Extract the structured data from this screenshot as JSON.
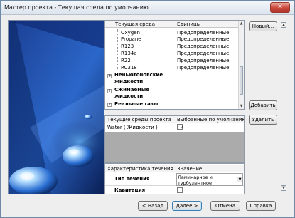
{
  "window": {
    "title": "Мастер проекта - Текущая среда по умолчанию",
    "close_label": "✕"
  },
  "fluids_table": {
    "headers": [
      "Текущая среда",
      "Единицы"
    ],
    "items": [
      {
        "name": "Oxygen",
        "units": "Предопределенные"
      },
      {
        "name": "Propane",
        "units": "Предопределенные"
      },
      {
        "name": "R123",
        "units": "Предопределенные"
      },
      {
        "name": "R134a",
        "units": "Предопределенные"
      },
      {
        "name": "R22",
        "units": "Предопределенные"
      },
      {
        "name": "RC318",
        "units": "Предопределенные"
      }
    ],
    "groups": [
      {
        "label": "Неньютоновские жидкости"
      },
      {
        "label": "Сжимаемые жидкости"
      },
      {
        "label": "Реальные газы"
      }
    ]
  },
  "project_fluids": {
    "headers": [
      "Текущие среды проекта",
      "Выбранные по умолчанию"
    ],
    "rows": [
      {
        "name": "Water ( Жидкости )",
        "checked": true
      }
    ]
  },
  "flow_props": {
    "headers": [
      "Характеристика течения",
      "Значение"
    ],
    "rows": [
      {
        "name": "Тип течения",
        "value": "Ламинарное и турбулентное"
      },
      {
        "name": "Кавитация",
        "value": ""
      }
    ]
  },
  "buttons": {
    "new": "Новый...",
    "add": "Добавить",
    "remove": "Удалить",
    "back": "< Назад",
    "next": "Далее >",
    "cancel": "Отмена",
    "help": "Справка"
  },
  "icons": {
    "close": "close-icon",
    "scroll_up": "scroll-up-arrow-icon",
    "scroll_down": "scroll-down-arrow-icon",
    "expand": "expand-plus-icon",
    "side_up": "side-collapse-up-icon",
    "side_down": "side-collapse-down-icon",
    "dropdown": "dropdown-arrow-icon",
    "check": "checkmark-icon"
  },
  "colors": {
    "title_bg": "#dbe3ec",
    "close_red": "#c9463a",
    "image_blue": "#0c2a6a"
  }
}
